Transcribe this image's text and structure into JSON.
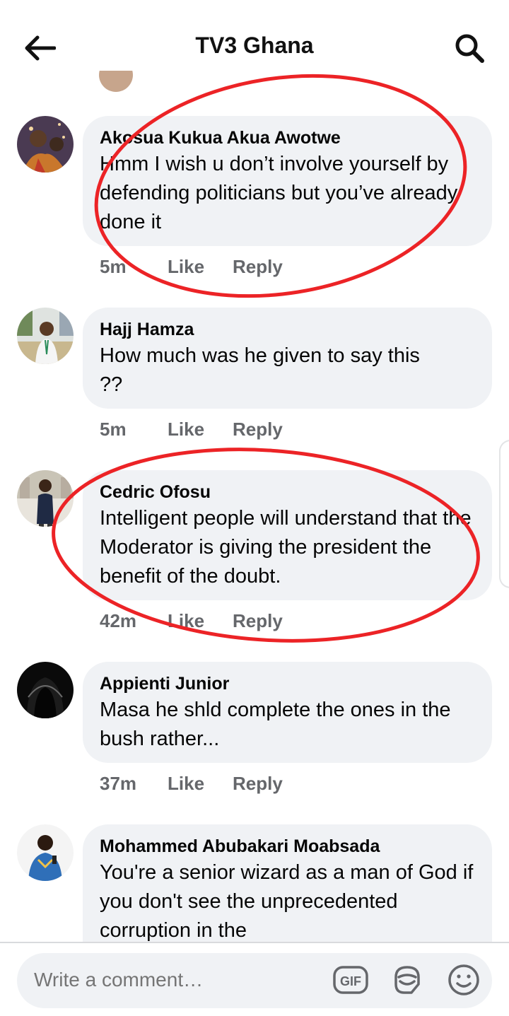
{
  "header": {
    "title": "TV3 Ghana"
  },
  "comments": [
    {
      "author": "Akosua Kukua Akua Awotwe",
      "text": "Hmm I wish u don’t involve yourself by defending politicians but you’ve already done it",
      "time": "5m",
      "like": "Like",
      "reply": "Reply"
    },
    {
      "author": "Hajj Hamza",
      "text": "How much was he given to say this ??",
      "time": "5m",
      "like": "Like",
      "reply": "Reply"
    },
    {
      "author": "Cedric Ofosu",
      "text": "Intelligent people will understand that the Moderator is giving the president the benefit of the doubt.",
      "time": "42m",
      "like": "Like",
      "reply": "Reply"
    },
    {
      "author": "Appienti Junior",
      "text": "Masa he shld complete the ones in the bush rather...",
      "time": "37m",
      "like": "Like",
      "reply": "Reply"
    },
    {
      "author": "Mohammed Abubakari Moabsada",
      "text": "You're a senior wizard as a man of God if you don't see the unprecedented corruption in the",
      "time": "",
      "like": "",
      "reply": ""
    }
  ],
  "composer": {
    "placeholder": "Write a comment…",
    "gif_label": "GIF"
  },
  "colors": {
    "annotation": "#ec2326",
    "bubble": "#f0f2f5",
    "meta": "#65676b"
  },
  "icons": {
    "back": "arrow-left-icon",
    "search": "search-icon",
    "gif": "gif-icon",
    "sticker": "sticker-icon",
    "emoji": "emoji-icon"
  }
}
